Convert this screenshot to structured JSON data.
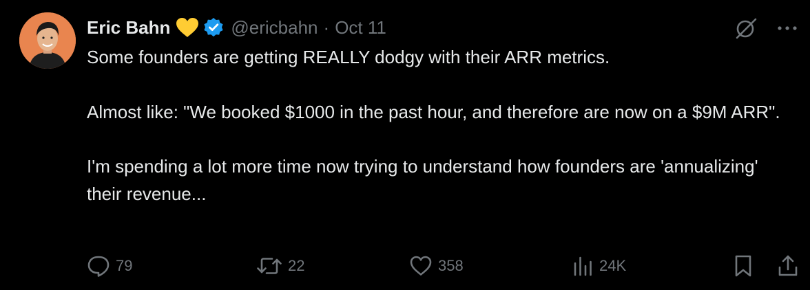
{
  "author": {
    "name": "Eric Bahn",
    "handle": "@ericbahn",
    "separator": "·",
    "date": "Oct 11"
  },
  "post": {
    "paragraphs": [
      "Some founders are getting REALLY dodgy with their ARR metrics.",
      "Almost like: \"We booked $1000 in the past hour, and therefore are now on a $9M ARR\".",
      "I'm spending a lot more time now trying to understand how founders are 'annualizing' their revenue..."
    ]
  },
  "actions": {
    "replies": "79",
    "reposts": "22",
    "likes": "358",
    "views": "24K"
  },
  "icons": {
    "heart": "yellow-heart-icon",
    "verified": "verified-badge-icon",
    "grok": "grok-icon",
    "more": "more-icon",
    "reply": "reply-icon",
    "repost": "repost-icon",
    "like": "like-icon",
    "views": "views-icon",
    "bookmark": "bookmark-icon",
    "share": "share-icon"
  },
  "colors": {
    "background": "#000000",
    "text": "#e7e9ea",
    "muted": "#71767b",
    "verified": "#1d9bf0",
    "heart": "#ffcc33",
    "avatar_bg": "#e9854f"
  }
}
